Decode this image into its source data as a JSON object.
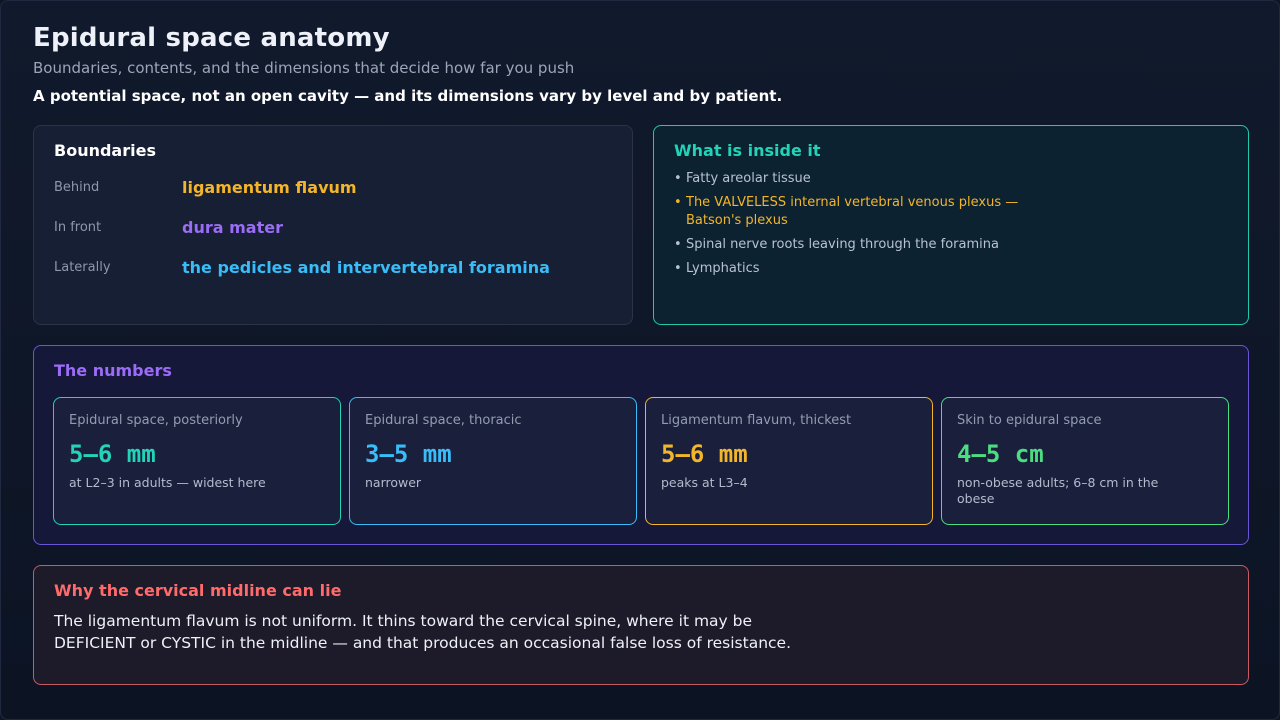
{
  "header": {
    "title": "Epidural space anatomy",
    "subtitle": "Boundaries, contents, and the dimensions that decide how far you push",
    "lede": "A potential space, not an open cavity — and its dimensions vary by level and by patient."
  },
  "boundaries": {
    "title": "Boundaries",
    "rows": [
      {
        "key": "Behind",
        "value": "ligamentum flavum",
        "color": "#f3b52a"
      },
      {
        "key": "In front",
        "value": "dura mater",
        "color": "#9b6cf6"
      },
      {
        "key": "Laterally",
        "value": "the pedicles and intervertebral foramina",
        "color": "#38bdf8"
      }
    ]
  },
  "contents": {
    "title": "What is inside it",
    "items": [
      {
        "line1": "Fatty areolar tissue",
        "line2": ""
      },
      {
        "line1": "The VALVELESS internal vertebral venous plexus —",
        "line2": "Batson's plexus"
      },
      {
        "line1": "Spinal nerve roots leaving through the foramina",
        "line2": ""
      },
      {
        "line1": "Lymphatics",
        "line2": ""
      }
    ],
    "bullet": "•"
  },
  "numbers": {
    "title": "The numbers",
    "cards": [
      {
        "label": "Epidural space, posteriorly",
        "value": "5–6 mm",
        "note": "at L2–3 in adults — widest here",
        "color": "#22d3b7"
      },
      {
        "label": "Epidural space, thoracic",
        "value": "3–5 mm",
        "note": "narrower",
        "color": "#38bdf8"
      },
      {
        "label": "Ligamentum flavum, thickest",
        "value": "5–6 mm",
        "note": "peaks at L3–4",
        "color": "#f3b52a"
      },
      {
        "label": "Skin to epidural space",
        "value": "4–5 cm",
        "note": "non-obese adults; 6–8 cm in the obese",
        "color": "#4ade80"
      }
    ]
  },
  "cervical": {
    "title": "Why the cervical midline can lie",
    "line1": "The ligamentum flavum is not uniform. It thins toward the cervical spine, where it may be",
    "line2": "DEFICIENT or CYSTIC in the midline — and that produces an occasional false loss of resistance."
  },
  "colors": {
    "highlight_bullet": "#f3b52a"
  }
}
